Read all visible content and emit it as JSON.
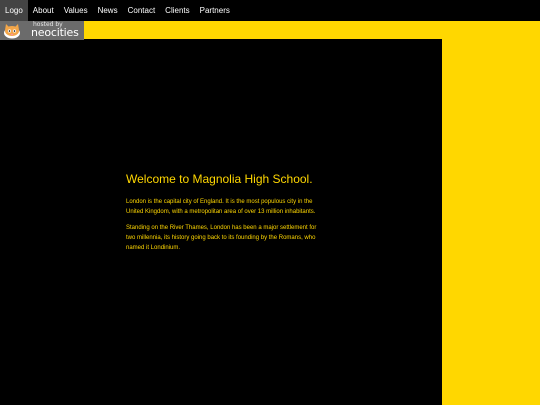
{
  "nav": {
    "items": [
      {
        "label": "Logo"
      },
      {
        "label": "About"
      },
      {
        "label": "Values"
      },
      {
        "label": "News"
      },
      {
        "label": "Contact"
      },
      {
        "label": "Clients"
      },
      {
        "label": "Partners"
      }
    ]
  },
  "badge": {
    "small_text": "hosted by",
    "main_text": "neocities",
    "mascot_icon": "cat-icon"
  },
  "content": {
    "headline": "Welcome to Magnolia High School.",
    "paragraph1": "London is the capital city of England. It is the most populous city in the United Kingdom, with a metropolitan area of over 13 million inhabitants.",
    "paragraph2": "Standing on the River Thames, London has been a major settlement for two millennia, its history going back to its founding by the Romans, who named it Londinium."
  },
  "colors": {
    "accent": "#FFD700",
    "background": "#000000",
    "nav_active": "#444444"
  }
}
